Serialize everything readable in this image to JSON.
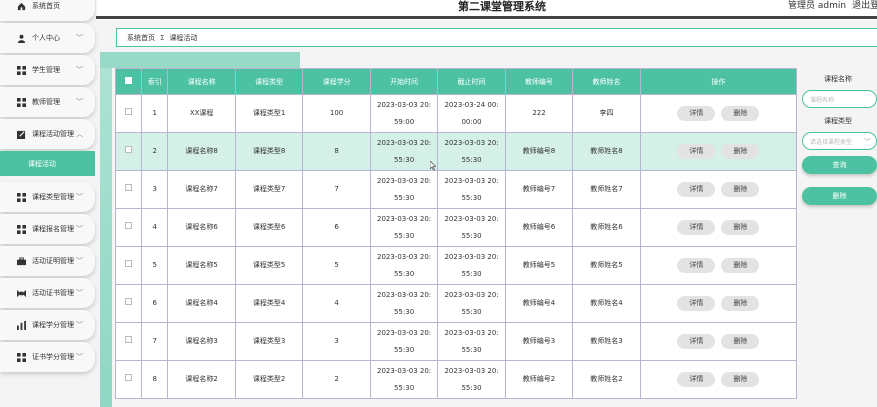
{
  "header": {
    "title": "第二课堂管理系统",
    "user_label": "管理员 admin",
    "logout": "退出登录"
  },
  "sidebar": {
    "items": [
      {
        "label": "系统首页",
        "icon": "home-icon"
      },
      {
        "label": "个人中心",
        "icon": "user-icon"
      },
      {
        "label": "学生管理",
        "icon": "grid-icon"
      },
      {
        "label": "教师管理",
        "icon": "grid-icon"
      },
      {
        "label": "课程活动管理",
        "icon": "edit-icon"
      },
      {
        "label": "课程类型管理",
        "icon": "grid-icon"
      },
      {
        "label": "课程报名管理",
        "icon": "grid-icon"
      },
      {
        "label": "活动证明管理",
        "icon": "briefcase-icon"
      },
      {
        "label": "活动证书管理",
        "icon": "certificate-icon"
      },
      {
        "label": "课程学分管理",
        "icon": "bar-chart-icon"
      },
      {
        "label": "证书学分管理",
        "icon": "grid-icon"
      }
    ],
    "active_sub": "课程活动"
  },
  "breadcrumb": {
    "home": "系统首页",
    "sep": "Σ",
    "current": "课程活动"
  },
  "table": {
    "columns": [
      "索引",
      "课程名称",
      "课程类型",
      "课程学分",
      "开始时间",
      "截止时间",
      "教师编号",
      "教师姓名",
      "操作"
    ],
    "detail_label": "详情",
    "delete_label": "删除",
    "rows": [
      {
        "idx": "1",
        "name": "XX课程",
        "type": "课程类型1",
        "credit": "100",
        "start_date": "2023-03-03 20:",
        "start_time": "59:00",
        "end_date": "2023-03-24 00:",
        "end_time": "00:00",
        "tno": "222",
        "tname": "李四"
      },
      {
        "idx": "2",
        "name": "课程名称8",
        "type": "课程类型8",
        "credit": "8",
        "start_date": "2023-03-03 20:",
        "start_time": "55:30",
        "end_date": "2023-03-03 20:",
        "end_time": "55:30",
        "tno": "教师编号8",
        "tname": "教师姓名8"
      },
      {
        "idx": "3",
        "name": "课程名称7",
        "type": "课程类型7",
        "credit": "7",
        "start_date": "2023-03-03 20:",
        "start_time": "55:30",
        "end_date": "2023-03-03 20:",
        "end_time": "55:30",
        "tno": "教师编号7",
        "tname": "教师姓名7"
      },
      {
        "idx": "4",
        "name": "课程名称6",
        "type": "课程类型6",
        "credit": "6",
        "start_date": "2023-03-03 20:",
        "start_time": "55:30",
        "end_date": "2023-03-03 20:",
        "end_time": "55:30",
        "tno": "教师编号6",
        "tname": "教师姓名6"
      },
      {
        "idx": "5",
        "name": "课程名称5",
        "type": "课程类型5",
        "credit": "5",
        "start_date": "2023-03-03 20:",
        "start_time": "55:30",
        "end_date": "2023-03-03 20:",
        "end_time": "55:30",
        "tno": "教师编号5",
        "tname": "教师姓名5"
      },
      {
        "idx": "6",
        "name": "课程名称4",
        "type": "课程类型4",
        "credit": "4",
        "start_date": "2023-03-03 20:",
        "start_time": "55:30",
        "end_date": "2023-03-03 20:",
        "end_time": "55:30",
        "tno": "教师编号4",
        "tname": "教师姓名4"
      },
      {
        "idx": "7",
        "name": "课程名称3",
        "type": "课程类型3",
        "credit": "3",
        "start_date": "2023-03-03 20:",
        "start_time": "55:30",
        "end_date": "2023-03-03 20:",
        "end_time": "55:30",
        "tno": "教师编号3",
        "tname": "教师姓名3"
      },
      {
        "idx": "8",
        "name": "课程名称2",
        "type": "课程类型2",
        "credit": "2",
        "start_date": "2023-03-03 20:",
        "start_time": "55:30",
        "end_date": "2023-03-03 20:",
        "end_time": "55:30",
        "tno": "教师编号2",
        "tname": "教师姓名2"
      }
    ]
  },
  "search": {
    "name_label": "课程名称",
    "name_placeholder": "课程名称",
    "type_label": "课程类型",
    "type_placeholder": "请选择课程类型",
    "query_button": "查询",
    "delete_button": "删除"
  },
  "colors": {
    "accent": "#4cc2a2",
    "highlight_row": "#d5f0e7"
  }
}
